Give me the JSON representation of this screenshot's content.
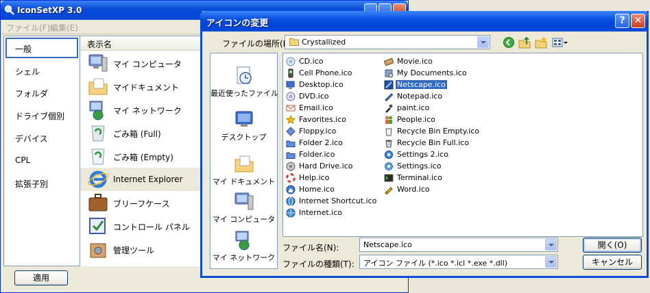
{
  "main_window": {
    "title": "IconSetXP 3.0",
    "menu": [
      "ファイル(F)",
      "編集(E)"
    ],
    "nav_items": [
      "一般",
      "シェル",
      "フォルダ",
      "ドライブ個別",
      "デバイス",
      "CPL",
      "拡張子別"
    ],
    "list_header": "表示名",
    "list_items": [
      {
        "label": "マイ コンピュータ",
        "icon": "my-computer-icon"
      },
      {
        "label": "マイドキュメント",
        "icon": "my-documents-icon"
      },
      {
        "label": "マイ ネットワーク",
        "icon": "my-network-icon"
      },
      {
        "label": "ごみ箱 (Full)",
        "icon": "recycle-bin-full-icon"
      },
      {
        "label": "ごみ箱 (Empty)",
        "icon": "recycle-bin-empty-icon"
      },
      {
        "label": "Internet Explorer",
        "icon": "internet-explorer-icon",
        "selected": true
      },
      {
        "label": "ブリーフケース",
        "icon": "briefcase-icon"
      },
      {
        "label": "コントロール パネル",
        "icon": "control-panel-icon"
      },
      {
        "label": "管理ツール",
        "icon": "admin-tools-icon"
      }
    ],
    "apply_label": "適用"
  },
  "dialog": {
    "title": "アイコンの変更",
    "look_in_label": "ファイルの場所(I):",
    "look_in_value": "Crystallized",
    "places": [
      "最近使ったファイル",
      "デスクトップ",
      "マイ ドキュメント",
      "マイ コンピュータ",
      "マイ ネットワーク"
    ],
    "files_col1": [
      "CD.ico",
      "Cell Phone.ico",
      "Desktop.ico",
      "DVD.ico",
      "Email.ico",
      "Favorites.ico",
      "Floppy.ico",
      "Folder 2.ico",
      "Folder.ico",
      "Hard Drive.ico",
      "Help.ico",
      "Home.ico",
      "Internet Shortcut.ico",
      "Internet.ico"
    ],
    "files_col2": [
      "Movie.ico",
      "My Documents.ico",
      "Netscape.ico",
      "Notepad.ico",
      "paint.ico",
      "People.ico",
      "Recycle Bin Empty.ico",
      "Recycle Bin Full.ico",
      "Settings 2.ico",
      "Settings.ico",
      "Terminal.ico",
      "Word.ico"
    ],
    "selected_file": "Netscape.ico",
    "file_name_label": "ファイル名(N):",
    "file_name_value": "Netscape.ico",
    "file_type_label": "ファイルの種類(T):",
    "file_type_value": "アイコン ファイル (*.ico *.icl *.exe *.dll)",
    "open_label": "開く(O)",
    "cancel_label": "キャンセル",
    "help_glyph": "?",
    "close_glyph": "✕"
  },
  "colors": {
    "title_blue": "#0a4bd8",
    "selection_blue": "#316ac5",
    "face": "#ece9d8"
  }
}
